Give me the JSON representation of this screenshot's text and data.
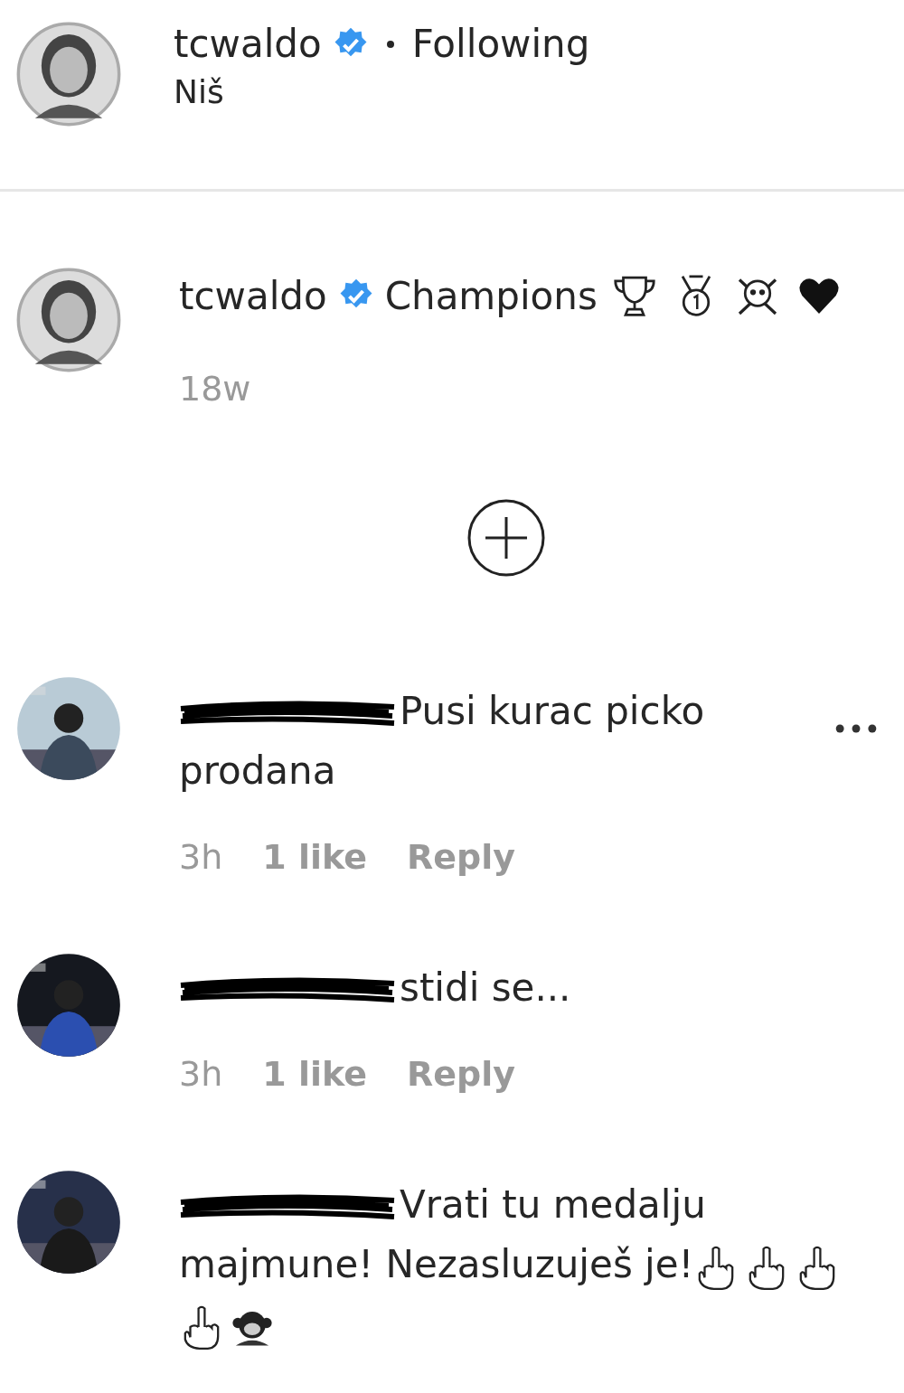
{
  "header": {
    "username": "tcwaldo",
    "verified": true,
    "follow_status": "Following",
    "location": "Niš"
  },
  "caption": {
    "username": "tcwaldo",
    "verified": true,
    "text": "Champions",
    "time": "18w"
  },
  "comments": [
    {
      "redacted": true,
      "text": "Pusi kurac picko prodana",
      "time": "3h",
      "likes": "1 like",
      "reply": "Reply",
      "has_menu": true
    },
    {
      "redacted": true,
      "text": "stidi se...",
      "time": "3h",
      "likes": "1 like",
      "reply": "Reply",
      "has_menu": false
    },
    {
      "redacted": true,
      "text": "Vrati tu medalju majmune! Nezasluzuješ je!",
      "has_menu": false
    }
  ]
}
